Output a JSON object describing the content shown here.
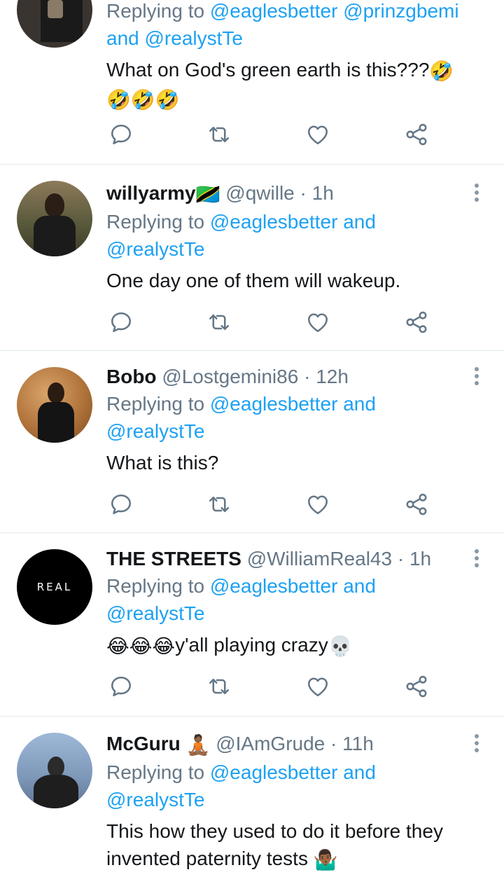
{
  "tweets": [
    {
      "reply_prefix": "Replying to",
      "mentions_line1": "@eaglesbetter @prinzgbemi",
      "and_word": "and",
      "mentions_line2": "@realystTe",
      "text_line1": "What on God's green earth is this???",
      "text_line1_emoji": "🤣",
      "text_line2_emoji": "🤣🤣🤣"
    },
    {
      "name": "willyarmy",
      "flag": "🇹🇿",
      "handle": "@qwille",
      "separator": "·",
      "time": "1h",
      "reply_prefix": "Replying to",
      "mention_a": "@eaglesbetter",
      "and_word": "and",
      "mention_b": "@realystTe",
      "text": "One day one of them will wakeup."
    },
    {
      "name": "Bobo",
      "handle": "@Lostgemini86",
      "separator": "·",
      "time": "12h",
      "reply_prefix": "Replying to",
      "mention_a": "@eaglesbetter",
      "and_word": "and",
      "mention_b": "@realystTe",
      "text": "What is this?"
    },
    {
      "name": "THE STREETS",
      "handle": "@WilliamReal43",
      "separator": "·",
      "time": "1h",
      "avatar_text": "REAL",
      "reply_prefix": "Replying to",
      "mention_a": "@eaglesbetter",
      "and_word": "and",
      "mention_b": "@realystTe",
      "text_emoji_prefix": "😂😂😂",
      "text": "y'all playing crazy",
      "text_emoji_suffix": "💀"
    },
    {
      "name": "McGuru",
      "name_emoji": "🧘🏾",
      "handle": "@IAmGrude",
      "separator": "·",
      "time": "11h",
      "reply_prefix": "Replying to",
      "mention_a": "@eaglesbetter",
      "and_word": "and",
      "mention_b": "@realystTe",
      "text_line1": "This how they used to do it before they",
      "text_line2": "invented paternity tests",
      "text_line2_emoji": "🤷🏾‍♂️"
    }
  ],
  "action_icons": [
    "reply-icon",
    "retweet-icon",
    "like-icon",
    "share-icon"
  ],
  "colors": {
    "link": "#1da1f2",
    "muted": "#657786",
    "divider": "#e1e8ed",
    "icon": "#657786"
  }
}
